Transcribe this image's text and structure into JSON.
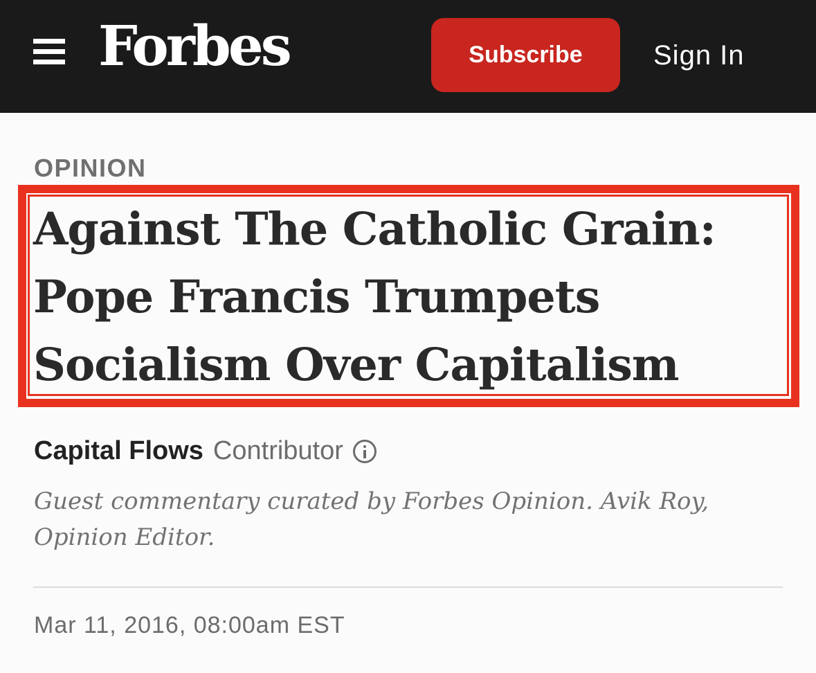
{
  "header": {
    "logo_text": "Forbes",
    "menu_icon": "hamburger-menu-icon",
    "subscribe_label": "Subscribe",
    "signin_label": "Sign In",
    "background_color": "#1a1a1a",
    "subscribe_color": "#c8261f"
  },
  "article": {
    "section": "OPINION",
    "headline": "Against The Catholic Grain: Pope Francis Trumpets Socialism Over Capitalism",
    "highlight_color": "#e8321f",
    "author_name": "Capital Flows",
    "author_role": "Contributor",
    "info_icon": "info-circle-icon",
    "author_description": "Guest commentary curated by Forbes Opinion. Avik Roy, Opinion Editor.",
    "published": "Mar 11, 2016, 08:00am EST"
  }
}
